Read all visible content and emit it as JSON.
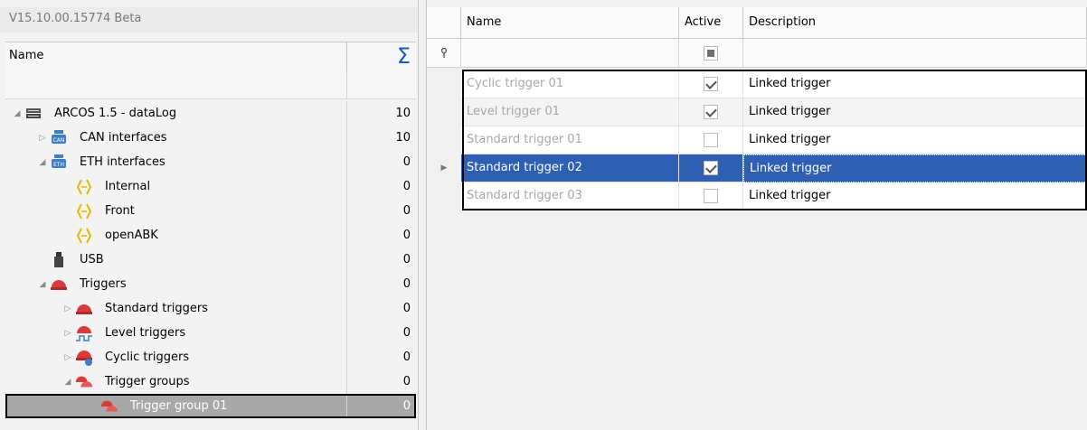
{
  "version": "V15.10.00.15774 Beta",
  "tree": {
    "header_name": "Name",
    "header_sum": "Σ",
    "rows": [
      {
        "label": "ARCOS 1.5 - dataLog",
        "count": "10",
        "level": 0,
        "expander": "◢",
        "icon": "device-icon"
      },
      {
        "label": "CAN interfaces",
        "count": "10",
        "level": 1,
        "expander": "▷",
        "icon": "can-icon"
      },
      {
        "label": "ETH interfaces",
        "count": "0",
        "level": 1,
        "expander": "◢",
        "icon": "eth-icon"
      },
      {
        "label": "Internal",
        "count": "0",
        "level": 2,
        "expander": "",
        "icon": "bracket-icon"
      },
      {
        "label": "Front",
        "count": "0",
        "level": 2,
        "expander": "",
        "icon": "bracket-icon"
      },
      {
        "label": "openABK",
        "count": "0",
        "level": 2,
        "expander": "",
        "icon": "bracket-icon"
      },
      {
        "label": "USB",
        "count": "0",
        "level": 1,
        "expander": "",
        "icon": "usb-icon"
      },
      {
        "label": "Triggers",
        "count": "0",
        "level": 1,
        "expander": "◢",
        "icon": "trigger-icon"
      },
      {
        "label": "Standard triggers",
        "count": "0",
        "level": 2,
        "expander": "▷",
        "icon": "trigger-icon"
      },
      {
        "label": "Level triggers",
        "count": "0",
        "level": 2,
        "expander": "▷",
        "icon": "level-trigger-icon"
      },
      {
        "label": "Cyclic triggers",
        "count": "0",
        "level": 2,
        "expander": "▷",
        "icon": "cyclic-trigger-icon"
      },
      {
        "label": "Trigger groups",
        "count": "0",
        "level": 2,
        "expander": "◢",
        "icon": "trigger-group-icon"
      },
      {
        "label": "Trigger group 01",
        "count": "0",
        "level": 3,
        "expander": "",
        "icon": "trigger-group-icon",
        "selected": true
      }
    ]
  },
  "grid": {
    "headers": {
      "name": "Name",
      "active": "Active",
      "description": "Description"
    },
    "filter_icon": "pin-icon",
    "rows": [
      {
        "name": "Cyclic trigger 01",
        "active": true,
        "description": "Linked trigger"
      },
      {
        "name": "Level trigger 01",
        "active": true,
        "description": "Linked trigger"
      },
      {
        "name": "Standard trigger 01",
        "active": false,
        "description": "Linked trigger"
      },
      {
        "name": "Standard trigger 02",
        "active": true,
        "description": "Linked trigger",
        "selected": true,
        "indicator": "▶"
      },
      {
        "name": "Standard trigger 03",
        "active": false,
        "description": "Linked trigger"
      }
    ]
  },
  "colors": {
    "selection": "#2f5fb3",
    "sum": "#1b58c4",
    "trigger_red": "#d93a3a"
  }
}
